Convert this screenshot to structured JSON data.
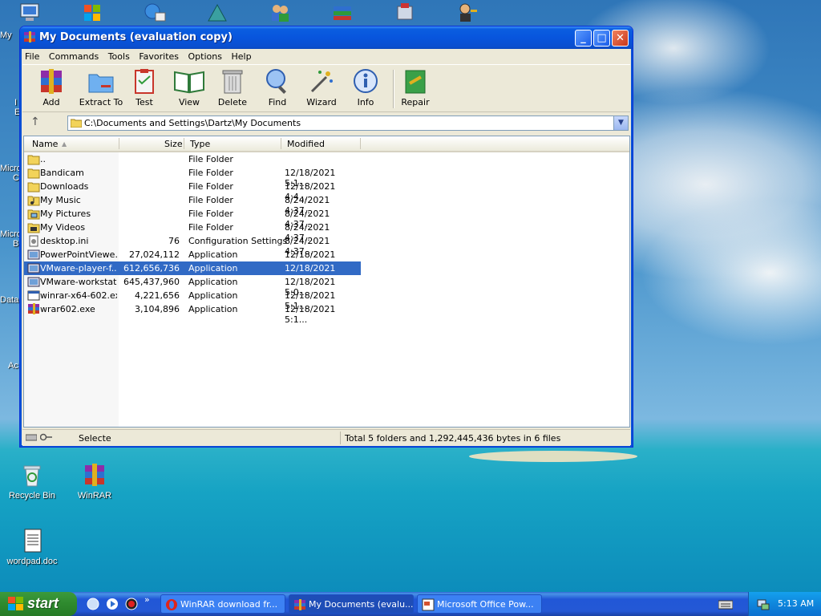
{
  "desktop": {
    "icons": [
      {
        "label": "Recycle Bin",
        "icon": "recycle-bin-icon"
      },
      {
        "label": "WinRAR",
        "icon": "winrar-icon"
      },
      {
        "label": "wordpad.doc",
        "icon": "document-icon"
      }
    ],
    "left_clipped": [
      "My",
      "I",
      "E",
      "Micro",
      "C",
      "Micro",
      "B",
      "Data",
      "Ac"
    ]
  },
  "window": {
    "title": "My Documents (evaluation copy)",
    "menu": [
      "File",
      "Commands",
      "Tools",
      "Favorites",
      "Options",
      "Help"
    ],
    "toolbar": [
      "Add",
      "Extract To",
      "Test",
      "View",
      "Delete",
      "Find",
      "Wizard",
      "Info",
      "Repair"
    ],
    "address": "C:\\Documents and Settings\\Dartz\\My Documents",
    "columns": {
      "name": "Name",
      "size": "Size",
      "type": "Type",
      "modified": "Modified"
    },
    "files": [
      {
        "name": "..",
        "size": "",
        "type": "File Folder",
        "modified": "",
        "icon": "folder-up"
      },
      {
        "name": "Bandicam",
        "size": "",
        "type": "File Folder",
        "modified": "12/18/2021 5:1...",
        "icon": "folder"
      },
      {
        "name": "Downloads",
        "size": "",
        "type": "File Folder",
        "modified": "12/18/2021 4:4...",
        "icon": "folder"
      },
      {
        "name": "My Music",
        "size": "",
        "type": "File Folder",
        "modified": "8/24/2021 4:37...",
        "icon": "folder-music"
      },
      {
        "name": "My Pictures",
        "size": "",
        "type": "File Folder",
        "modified": "8/24/2021 4:37...",
        "icon": "folder-pictures"
      },
      {
        "name": "My Videos",
        "size": "",
        "type": "File Folder",
        "modified": "8/24/2021 4:37...",
        "icon": "folder-videos"
      },
      {
        "name": "desktop.ini",
        "size": "76",
        "type": "Configuration Settings",
        "modified": "8/24/2021 4:37...",
        "icon": "ini-file"
      },
      {
        "name": "PowerPointViewe...",
        "size": "27,024,112",
        "type": "Application",
        "modified": "12/18/2021 5:0...",
        "icon": "app"
      },
      {
        "name": "VMware-player-f...",
        "size": "612,656,736",
        "type": "Application",
        "modified": "12/18/2021 5:1...",
        "icon": "app",
        "selected": true
      },
      {
        "name": "VMware-workstat...",
        "size": "645,437,960",
        "type": "Application",
        "modified": "12/18/2021 5:0...",
        "icon": "app"
      },
      {
        "name": "winrar-x64-602.exe",
        "size": "4,221,656",
        "type": "Application",
        "modified": "12/18/2021 5:1...",
        "icon": "exe"
      },
      {
        "name": "wrar602.exe",
        "size": "3,104,896",
        "type": "Application",
        "modified": "12/18/2021 5:1...",
        "icon": "winrar-exe"
      }
    ],
    "status_left": "Selecte",
    "status_right": "Total 5 folders and 1,292,445,436 bytes in 6 files"
  },
  "taskbar": {
    "start_label": "start",
    "tasks": [
      {
        "label": "WinRAR download fr...",
        "icon": "opera-icon",
        "active": false
      },
      {
        "label": "My Documents (evalu...",
        "icon": "winrar-icon",
        "active": true
      },
      {
        "label": "Microsoft Office Pow...",
        "icon": "powerpoint-icon",
        "active": false
      }
    ],
    "quick_launch_more": "»",
    "clock": "5:13 AM"
  }
}
